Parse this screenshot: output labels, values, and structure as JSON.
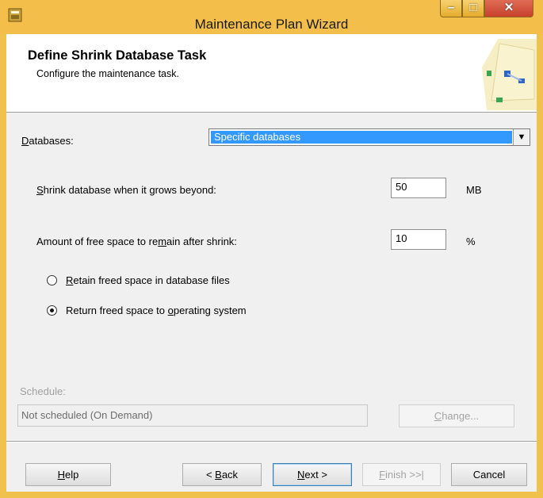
{
  "window": {
    "title": "Maintenance Plan Wizard",
    "controls": {
      "minimize_icon": "minimize-icon",
      "maximize_icon": "maximize-icon",
      "close_icon": "close-icon"
    }
  },
  "header": {
    "title": "Define Shrink Database Task",
    "subtitle": "Configure the maintenance task."
  },
  "form": {
    "databases_label_pre": "",
    "databases_label_ul": "D",
    "databases_label_post": "atabases:",
    "databases_value": "Specific databases",
    "shrink_label_ul": "S",
    "shrink_label_post": "hrink database when it grows beyond:",
    "shrink_value": "50",
    "shrink_unit": "MB",
    "free_label_pre": "Amount of free space to re",
    "free_label_ul": "m",
    "free_label_post": "ain after shrink:",
    "free_value": "10",
    "free_unit": "%",
    "radio_retain_ul": "R",
    "radio_retain_post": "etain freed space in database files",
    "radio_return_pre": "Return freed space to ",
    "radio_return_ul": "o",
    "radio_return_post": "perating system",
    "selected_option": "return"
  },
  "schedule": {
    "label": "Schedule:",
    "value": "Not scheduled (On Demand)",
    "change_ul": "C",
    "change_post": "hange..."
  },
  "buttons": {
    "help_ul": "H",
    "help_post": "elp",
    "back_pre": "< ",
    "back_ul": "B",
    "back_post": "ack",
    "next_ul": "N",
    "next_post": "ext >",
    "finish_ul": "F",
    "finish_post": "inish >>|",
    "cancel": "Cancel"
  },
  "colors": {
    "titlebar": "#f3bf4a",
    "selection": "#3399ff"
  }
}
